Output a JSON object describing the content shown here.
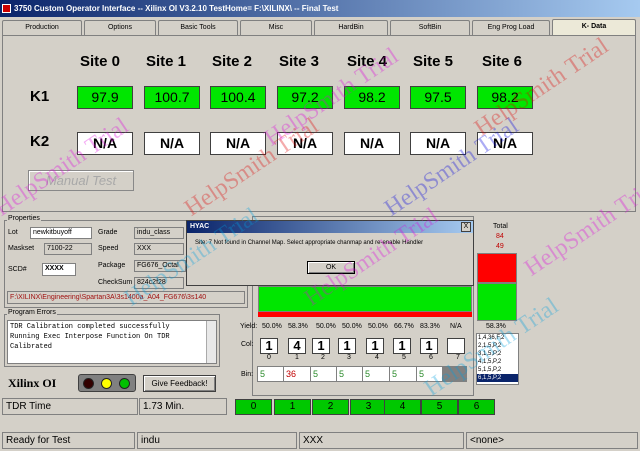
{
  "window": {
    "title": "3750 Custom Operator Interface -- Xilinx OI V3.2.10  TestHome=  F:\\XILINX\\  -- Final Test"
  },
  "tabs": [
    "Production",
    "Options",
    "Basic Tools",
    "Misc",
    "HardBin",
    "SoftBin",
    "Eng Prog Load",
    "K- Data"
  ],
  "kdata": {
    "sites": [
      "Site 0",
      "Site 1",
      "Site 2",
      "Site 3",
      "Site 4",
      "Site 5",
      "Site 6"
    ],
    "row1_label": "K1",
    "row2_label": "K2",
    "k1": [
      "97.9",
      "100.7",
      "100.4",
      "97.2",
      "98.2",
      "97.5",
      "98.2"
    ],
    "k2": [
      "N/A",
      "N/A",
      "N/A",
      "N/A",
      "N/A",
      "N/A",
      "N/A"
    ],
    "manual_test": "Manual Test"
  },
  "properties": {
    "group": "Properties",
    "lot_label": "Lot",
    "lot": "newkitbuyoff",
    "maskset_label": "Maskset",
    "maskset": "7100-22",
    "scd_label": "SCD#",
    "scd": "XXXX",
    "grade_label": "Grade",
    "grade": "indu_class",
    "speed_label": "Speed",
    "speed": "XXX",
    "package_label": "Package",
    "package": "FG676_Octal",
    "checksum_label": "CheckSum",
    "checksum": "824c2f28",
    "path": "F:\\XILINX\\Engineering\\Spartan3A\\3s1400a_A04_FG676\\3s140"
  },
  "program_errors": {
    "label": "Program Errors",
    "lines": [
      "TDR Calibration completed successfully",
      "Running Exec Interpose Function On TDR",
      "Calibrated"
    ]
  },
  "brand": "Xilinx OI",
  "feedback_button": "Give Feedback!",
  "tdr": {
    "label": "TDR Time",
    "value": "1.73 Min."
  },
  "site_buttons": [
    "0",
    "1",
    "2",
    "3",
    "4",
    "5",
    "6"
  ],
  "dialog": {
    "title": "HYAC",
    "close": "X",
    "message": "Site: 7 Not found in Channel Map. Select appropriate chanmap and re-enable Handler",
    "ok": "OK"
  },
  "yield": {
    "label": "Yield:",
    "values": [
      "50.0%",
      "58.3%",
      "50.0%",
      "50.0%",
      "50.0%",
      "66.7%",
      "83.3%",
      "N/A"
    ],
    "col_label": "Col:",
    "cols": [
      "1",
      "4",
      "1",
      "1",
      "1",
      "1",
      "1",
      ""
    ],
    "col_numbers": [
      "0",
      "1",
      "2",
      "3",
      "4",
      "5",
      "6",
      "7"
    ],
    "bin_label": "Bin:",
    "bins": [
      "5",
      "36",
      "5",
      "5",
      "5",
      "5",
      "5",
      ""
    ],
    "total_label": "Total",
    "total": "84",
    "total_pass": "49",
    "total_yield": "58.3%"
  },
  "bin_list": [
    "1,4,36,F,2",
    "2,1,5,P,2",
    "3,1,5,P,2",
    "4,1,5,P,2",
    "5,1,5,P,2",
    "6,1,5,P,2"
  ],
  "statusbar": {
    "ready": "Ready for Test",
    "grade": "indu",
    "speed": "XXX",
    "handler": "<none>"
  },
  "watermark": "HelpSmith Trial",
  "colors": {
    "green": "#00e600",
    "red": "#ff0000",
    "title_blue": "#0a246a"
  }
}
